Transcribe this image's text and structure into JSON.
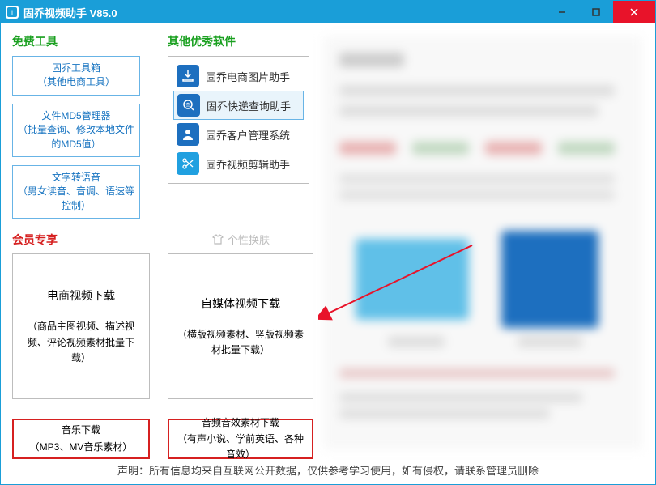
{
  "window": {
    "title": "固乔视频助手 V85.0"
  },
  "sections": {
    "free_tools": "免费工具",
    "other_soft": "其他优秀软件",
    "member": "会员专享",
    "skin": "个性换肤"
  },
  "free_tools": [
    {
      "line1": "固乔工具箱",
      "line2": "（其他电商工具）"
    },
    {
      "line1": "文件MD5管理器",
      "line2": "（批量查询、修改本地文件的MD5值）"
    },
    {
      "line1": "文字转语音",
      "line2": "（男女读音、音调、语速等控制）"
    }
  ],
  "other_soft": [
    {
      "icon": "download-icon",
      "label": "固乔电商图片助手",
      "color": "#1d6fbf"
    },
    {
      "icon": "search-express-icon",
      "label": "固乔快递查询助手",
      "color": "#1d6fbf",
      "highlight": true
    },
    {
      "icon": "person-icon",
      "label": "固乔客户管理系统",
      "color": "#1d6fbf"
    },
    {
      "icon": "scissors-icon",
      "label": "固乔视频剪辑助手",
      "color": "#20a0e0"
    }
  ],
  "cards": {
    "ecom": {
      "t1": "电商视频下载",
      "t2": "（商品主图视频、描述视频、评论视频素材批量下载）"
    },
    "media": {
      "t1": "自媒体视频下载",
      "t2": "（横版视频素材、竖版视频素材批量下载）"
    },
    "music": {
      "t1": "音乐下载",
      "t2": "（MP3、MV音乐素材）"
    },
    "audio": {
      "t1": "音频音效素材下载",
      "t2": "（有声小说、学前英语、各种音效）"
    }
  },
  "disclaimer": "声明：所有信息均来自互联网公开数据，仅供参考学习使用，如有侵权，请联系管理员删除"
}
